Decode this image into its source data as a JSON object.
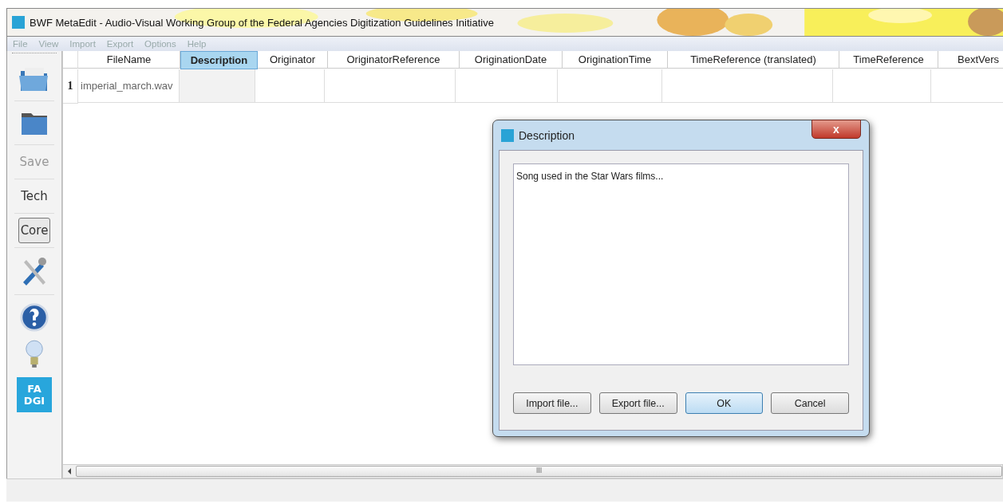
{
  "window": {
    "title": "BWF MetaEdit - Audio-Visual Working Group of the Federal Agencies Digitization Guidelines Initiative"
  },
  "menu": [
    "File",
    "View",
    "Import",
    "Export",
    "Options",
    "Help"
  ],
  "sidebar": {
    "items": [
      {
        "kind": "open-file"
      },
      {
        "kind": "open-folder"
      },
      {
        "kind": "text",
        "label": "Save",
        "disabled": true,
        "selected": false
      },
      {
        "kind": "text",
        "label": "Tech",
        "disabled": false,
        "selected": false
      },
      {
        "kind": "text",
        "label": "Core",
        "disabled": false,
        "selected": true
      },
      {
        "kind": "tools"
      },
      {
        "kind": "help"
      },
      {
        "kind": "bulb"
      },
      {
        "kind": "logo",
        "label": "FA DGI"
      }
    ]
  },
  "table": {
    "columns": [
      {
        "label": "FileName",
        "selected": false
      },
      {
        "label": "Description",
        "selected": true
      },
      {
        "label": "Originator",
        "selected": false
      },
      {
        "label": "OriginatorReference",
        "selected": false
      },
      {
        "label": "OriginationDate",
        "selected": false
      },
      {
        "label": "OriginationTime",
        "selected": false
      },
      {
        "label": "TimeReference (translated)",
        "selected": false
      },
      {
        "label": "TimeReference",
        "selected": false
      },
      {
        "label": "BextVers",
        "selected": false
      }
    ],
    "rows": [
      {
        "number": "1",
        "cells": [
          "imperial_march.wav",
          "",
          "",
          "",
          "",
          "",
          "",
          "",
          ""
        ]
      }
    ]
  },
  "scrollbar": {
    "grip": "III"
  },
  "dialog": {
    "title": "Description",
    "value": "Song used in the Star Wars films...",
    "close": "x",
    "buttons": [
      {
        "label": "Import file...",
        "default": false
      },
      {
        "label": "Export file...",
        "default": false
      },
      {
        "label": "OK",
        "default": true
      },
      {
        "label": "Cancel",
        "default": false
      }
    ]
  }
}
